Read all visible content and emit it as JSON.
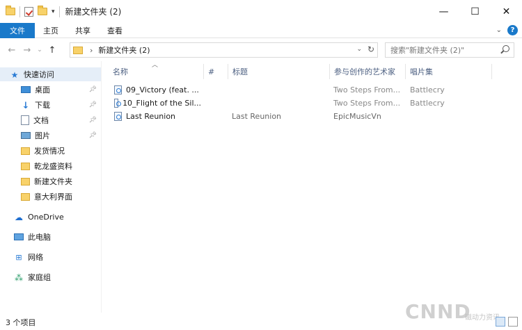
{
  "titlebar": {
    "title": "新建文件夹 (2)",
    "minimize": "—",
    "maximize": "☐",
    "close": "✕"
  },
  "ribbon": {
    "file_tab": "文件",
    "tabs": [
      "主页",
      "共享",
      "查看"
    ],
    "expand_icon": "chevron-down-icon",
    "help": "?"
  },
  "address": {
    "path": "新建文件夹 (2)",
    "separator": "›"
  },
  "search": {
    "placeholder": "搜索\"新建文件夹 (2)\""
  },
  "sidebar": {
    "quick_access": "快速访问",
    "items": [
      {
        "label": "桌面",
        "icon": "desktop-icon",
        "pinned": true
      },
      {
        "label": "下载",
        "icon": "download-icon",
        "pinned": true
      },
      {
        "label": "文档",
        "icon": "document-icon",
        "pinned": true
      },
      {
        "label": "图片",
        "icon": "picture-icon",
        "pinned": true
      },
      {
        "label": "发货情况",
        "icon": "folder-icon",
        "pinned": false
      },
      {
        "label": "乾龙盛资料",
        "icon": "folder-icon",
        "pinned": false
      },
      {
        "label": "新建文件夹",
        "icon": "folder-icon",
        "pinned": false
      },
      {
        "label": "意大利界面",
        "icon": "folder-icon",
        "pinned": false
      }
    ],
    "onedrive": "OneDrive",
    "this_pc": "此电脑",
    "network": "网络",
    "homegroup": "家庭组"
  },
  "columns": {
    "name": "名称",
    "number": "#",
    "title": "标题",
    "artist": "参与创作的艺术家",
    "album": "唱片集"
  },
  "files": [
    {
      "name": "09_Victory (feat. ...",
      "title": "",
      "artist": "Two Steps From...",
      "album": "Battlecry"
    },
    {
      "name": "10_Flight of the Sil...",
      "title": "",
      "artist": "Two Steps From...",
      "album": "Battlecry"
    },
    {
      "name": "Last Reunion",
      "title": "Last Reunion",
      "artist": "EpicMusicVn",
      "album": ""
    }
  ],
  "status": {
    "item_count": "3 个项目"
  },
  "watermark": {
    "text": "CNND",
    "sub": "磁动力资讯"
  }
}
